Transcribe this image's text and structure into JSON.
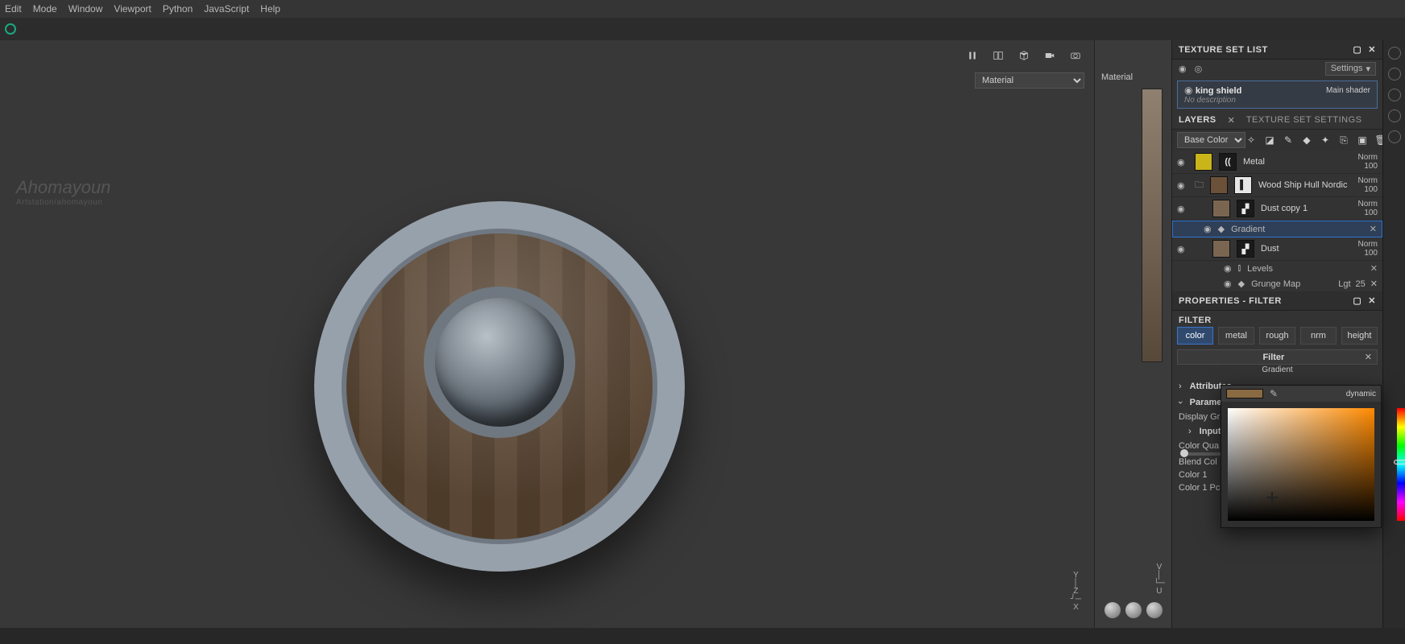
{
  "menu": {
    "items": [
      "Edit",
      "Mode",
      "Window",
      "Viewport",
      "Python",
      "JavaScript",
      "Help"
    ]
  },
  "viewport3d": {
    "shading_select": "Material",
    "watermark_name": "Ahomayoun",
    "watermark_sub": "Artstation/ahomayoun",
    "gizmo_y": "Y",
    "gizmo_x": "X",
    "gizmo_z": "Z"
  },
  "viewport2d": {
    "shading_select": "Material",
    "gizmo_v": "V",
    "gizmo_u": "U"
  },
  "toolbar_icons": [
    "pause-icon",
    "perspective-icon",
    "iso-icon",
    "camera-view-icon",
    "camera-icon"
  ],
  "texture_set_list": {
    "title": "TEXTURE SET LIST",
    "settings_label": "Settings",
    "item": {
      "name": "king shield",
      "shader": "Main shader",
      "description": "No description"
    }
  },
  "layers_panel": {
    "tab_layers": "LAYERS",
    "tab_settings": "TEXTURE SET SETTINGS",
    "channel_select": "Base Color",
    "layers": [
      {
        "name": "Metal",
        "mode": "Norm",
        "opacity": "100",
        "thumb": "#c9b51a",
        "mask": "((",
        "type": "fill"
      },
      {
        "name": "Wood Ship Hull Nordic",
        "mode": "Norm",
        "opacity": "100",
        "thumb": "#6b513a",
        "type": "folder"
      },
      {
        "name": "Dust copy 1",
        "mode": "Norm",
        "opacity": "100",
        "thumb": "#9a7a55",
        "type": "fill"
      },
      {
        "name": "Dust",
        "mode": "Norm",
        "opacity": "100",
        "thumb": "#9a7a55",
        "type": "fill"
      }
    ],
    "effect_gradient": {
      "label": "Gradient"
    },
    "effect_levels": {
      "label": "Levels"
    },
    "effect_grunge": {
      "label": "Grunge Map",
      "mode": "Lgt",
      "opacity": "25"
    }
  },
  "properties": {
    "title": "PROPERTIES - FILTER",
    "section": "FILTER",
    "channels": [
      "color",
      "metal",
      "rough",
      "nrm",
      "height"
    ],
    "active_channel": "color",
    "filter_title": "Filter",
    "filter_name": "Gradient",
    "attributes_label": "Attributes",
    "parameters_label": "Parame",
    "display_gr": "Display Gr",
    "input_label": "Input",
    "color_quality": "Color Qua",
    "blend_color": "Blend Col",
    "color1": "Color 1",
    "color1pc": "Color 1 Pc",
    "picker_dynamic": "dynamic"
  }
}
